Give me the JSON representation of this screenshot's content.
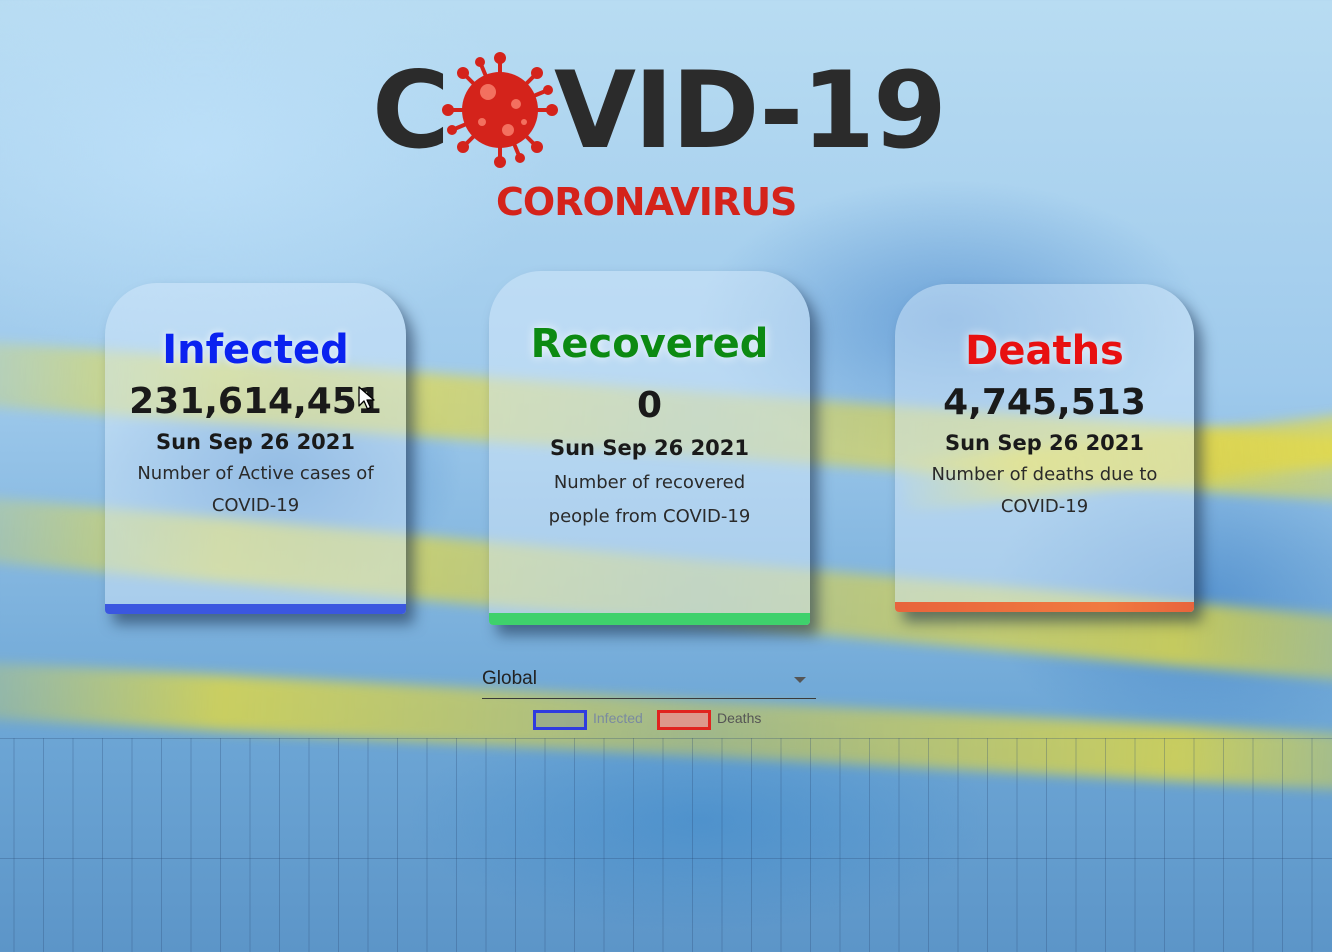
{
  "logo": {
    "title": "COVID-19",
    "subtitle": "CORONAVIRUS"
  },
  "cards": {
    "infected": {
      "title": "Infected",
      "count": "231,614,451",
      "date": "Sun Sep 26 2021",
      "description": "Number of Active cases of COVID-19",
      "color": "#0a22f0",
      "bar_color": "#3b57e0"
    },
    "recovered": {
      "title": "Recovered",
      "count": "0",
      "date": "Sun Sep 26 2021",
      "description": "Number of recovered people from COVID-19",
      "color": "#0c8a12",
      "bar_color": "#3fd16c"
    },
    "deaths": {
      "title": "Deaths",
      "count": "4,745,513",
      "date": "Sun Sep 26 2021",
      "description": "Number of deaths due to COVID-19",
      "color": "#e81010",
      "bar_color": "#e8643c"
    }
  },
  "country_select": {
    "selected": "Global"
  },
  "chart_data": {
    "type": "line",
    "legend": [
      {
        "name": "Infected",
        "color": "#2f3be0",
        "hidden": true
      },
      {
        "name": "Deaths",
        "color": "#e0241f",
        "hidden": false
      }
    ],
    "grid": true,
    "series": []
  }
}
